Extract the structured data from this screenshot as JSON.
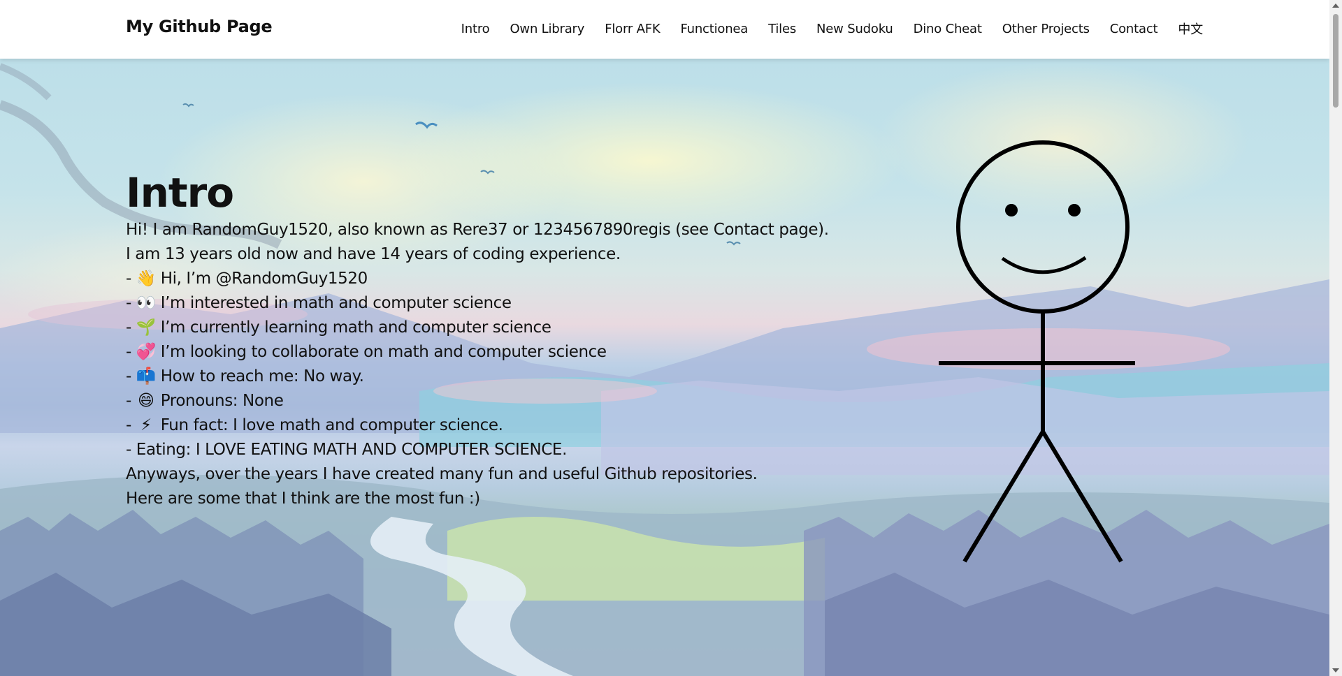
{
  "navbar": {
    "brand": "My Github Page",
    "links": [
      {
        "label": "Intro"
      },
      {
        "label": "Own Library"
      },
      {
        "label": "Florr AFK"
      },
      {
        "label": "Functionea"
      },
      {
        "label": "Tiles"
      },
      {
        "label": "New Sudoku"
      },
      {
        "label": "Dino Cheat"
      },
      {
        "label": "Other Projects"
      },
      {
        "label": "Contact"
      },
      {
        "label": "中文"
      }
    ]
  },
  "intro": {
    "heading": "Intro",
    "lines": [
      {
        "text": "Hi! I am RandomGuy1520, also known as Rere37 or 1234567890regis (see Contact page)."
      },
      {
        "text": "I am 13 years old now and have 14 years of coding experience."
      },
      {
        "prefix": "- ",
        "emoji": "👋",
        "text": " Hi, I’m @RandomGuy1520"
      },
      {
        "prefix": "- ",
        "emoji": "👀",
        "text": " I’m interested in math and computer science"
      },
      {
        "prefix": "- ",
        "emoji": "🌱",
        "text": " I’m currently learning math and computer science"
      },
      {
        "prefix": "- ",
        "emoji": "💞️",
        "text": " I’m looking to collaborate on math and computer science"
      },
      {
        "prefix": "- ",
        "emoji": "📫",
        "text": " How to reach me: No way."
      },
      {
        "prefix": "- ",
        "emoji": "😄",
        "text": " Pronouns: None"
      },
      {
        "prefix": "- ",
        "emoji": "⚡",
        "text": " Fun fact: I love math and computer science."
      },
      {
        "text": "- Eating: I LOVE EATING MATH AND COMPUTER SCIENCE."
      },
      {
        "text": "Anyways, over the years I have created many fun and useful Github repositories."
      },
      {
        "text": "Here are some that I think are the most fun :)"
      }
    ]
  },
  "colors": {
    "text": "#111111",
    "navbar_bg": "#ffffff",
    "stick_figure": "#000000"
  },
  "icons": {
    "stick_figure": "smiling-stick-figure-illustration"
  }
}
